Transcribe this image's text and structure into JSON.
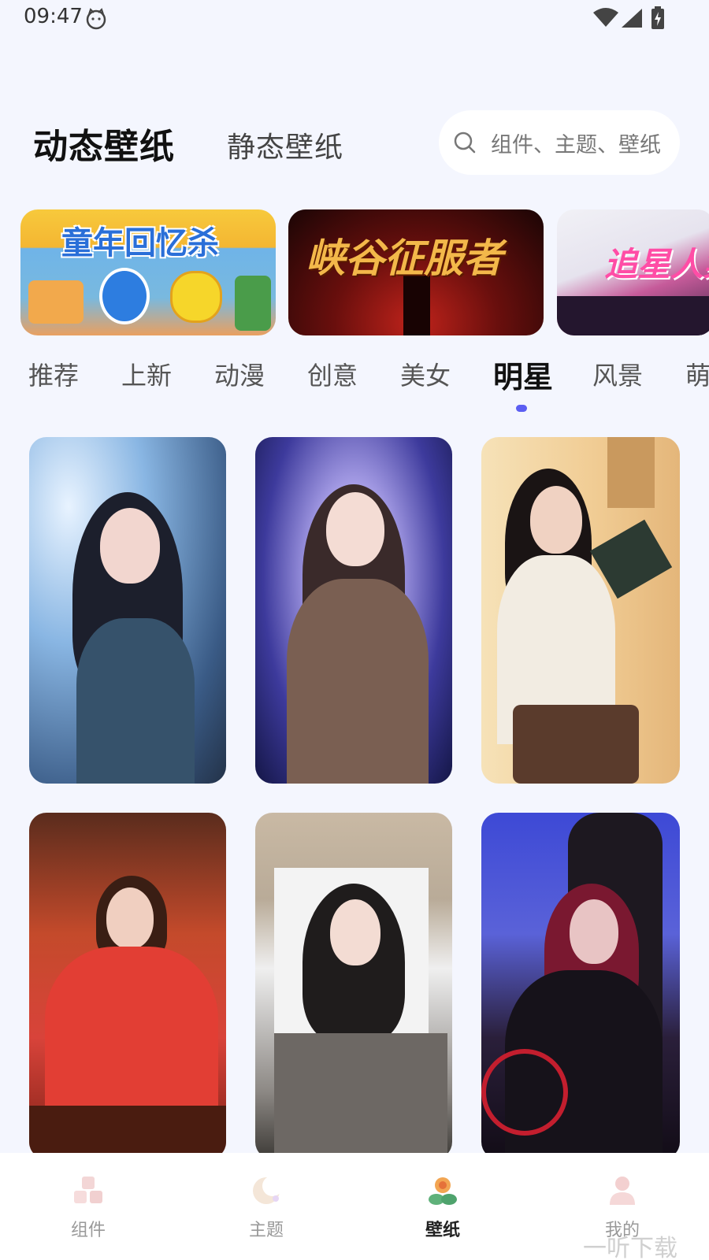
{
  "status_bar": {
    "time": "09:47"
  },
  "header": {
    "tab_dynamic": "动态壁纸",
    "tab_static": "静态壁纸",
    "search_placeholder": "组件、主题、壁纸"
  },
  "banners": [
    {
      "title": "童年回忆杀"
    },
    {
      "title": "峡谷征服者"
    },
    {
      "title": "追星人集"
    }
  ],
  "categories": {
    "items": [
      "推荐",
      "上新",
      "动漫",
      "创意",
      "美女",
      "明星",
      "风景",
      "萌"
    ],
    "selected": "明星"
  },
  "grid": {
    "count": 6
  },
  "bottom_nav": {
    "items": [
      {
        "label": "组件",
        "icon": "blocks-icon"
      },
      {
        "label": "主题",
        "icon": "moon-theme-icon"
      },
      {
        "label": "壁纸",
        "icon": "flower-wallpaper-icon"
      },
      {
        "label": "我的",
        "icon": "user-icon"
      }
    ],
    "active": "壁纸"
  },
  "watermark": "一听下载",
  "colors": {
    "background": "#f4f6fe",
    "accent": "#5b5ef2"
  }
}
